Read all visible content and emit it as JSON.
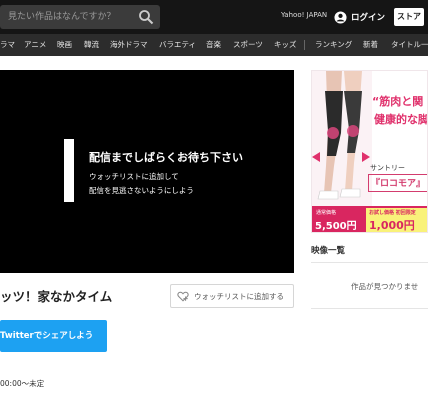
{
  "header": {
    "search_placeholder": "見たい作品はなんですか？",
    "yahoo_label": "Yahoo! JAPAN",
    "login_label": "ログイン",
    "store_label": "ストア"
  },
  "categories": [
    "ラマ",
    "アニメ",
    "映画",
    "韓流",
    "海外ドラマ",
    "バラエティ",
    "音楽",
    "スポーツ",
    "キッズ",
    "ランキング",
    "新着",
    "タイトル一覧"
  ],
  "player": {
    "title": "配信までしばらくお待ち下さい",
    "line1": "ウォッチリストに追加して",
    "line2": "配信を見逃さないようにしよう"
  },
  "show": {
    "title": "ッツ！家なかタイム",
    "watchlist_label": "ウォッチリストに追加する",
    "twitter_label": "Twitterでシェアしよう",
    "time": "00:00〜未定"
  },
  "ad": {
    "headline1": "“筋肉と関",
    "headline2": "健康的な脚",
    "brand": "サントリー",
    "product": "『ロコモア』",
    "price1_label": "通常価格",
    "price1": "5,500円",
    "price2_label": "お試し価格 初回限定",
    "price2": "1,000円"
  },
  "sidebar": {
    "title": "映像一覧",
    "empty_message": "作品が見つかりませ"
  },
  "colors": {
    "twitter": "#1da1f2",
    "ad_pink": "#e0316c",
    "topbar": "#151515"
  }
}
